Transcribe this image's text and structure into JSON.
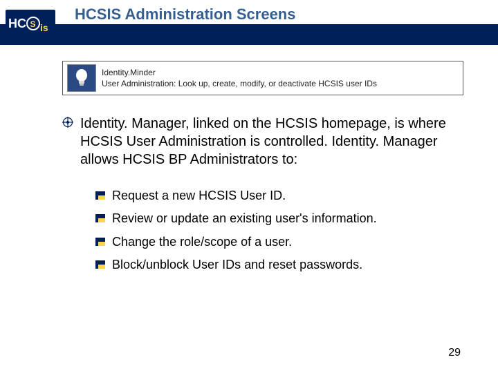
{
  "title": "HCSIS Administration Screens",
  "logo": {
    "text": "HCSis"
  },
  "infoBox": {
    "line1": "Identity.Minder",
    "line2": "User Administration: Look up, create, modify, or deactivate HCSIS user IDs"
  },
  "paragraph": "Identity. Manager, linked on the HCSIS homepage, is where HCSIS User Administration is controlled. Identity. Manager allows HCSIS BP Administrators to:",
  "subItems": [
    "Request a new HCSIS User ID.",
    "Review or update an existing user's information.",
    "Change the role/scope of a user.",
    "Block/unblock User IDs and reset passwords."
  ],
  "pageNumber": "29"
}
